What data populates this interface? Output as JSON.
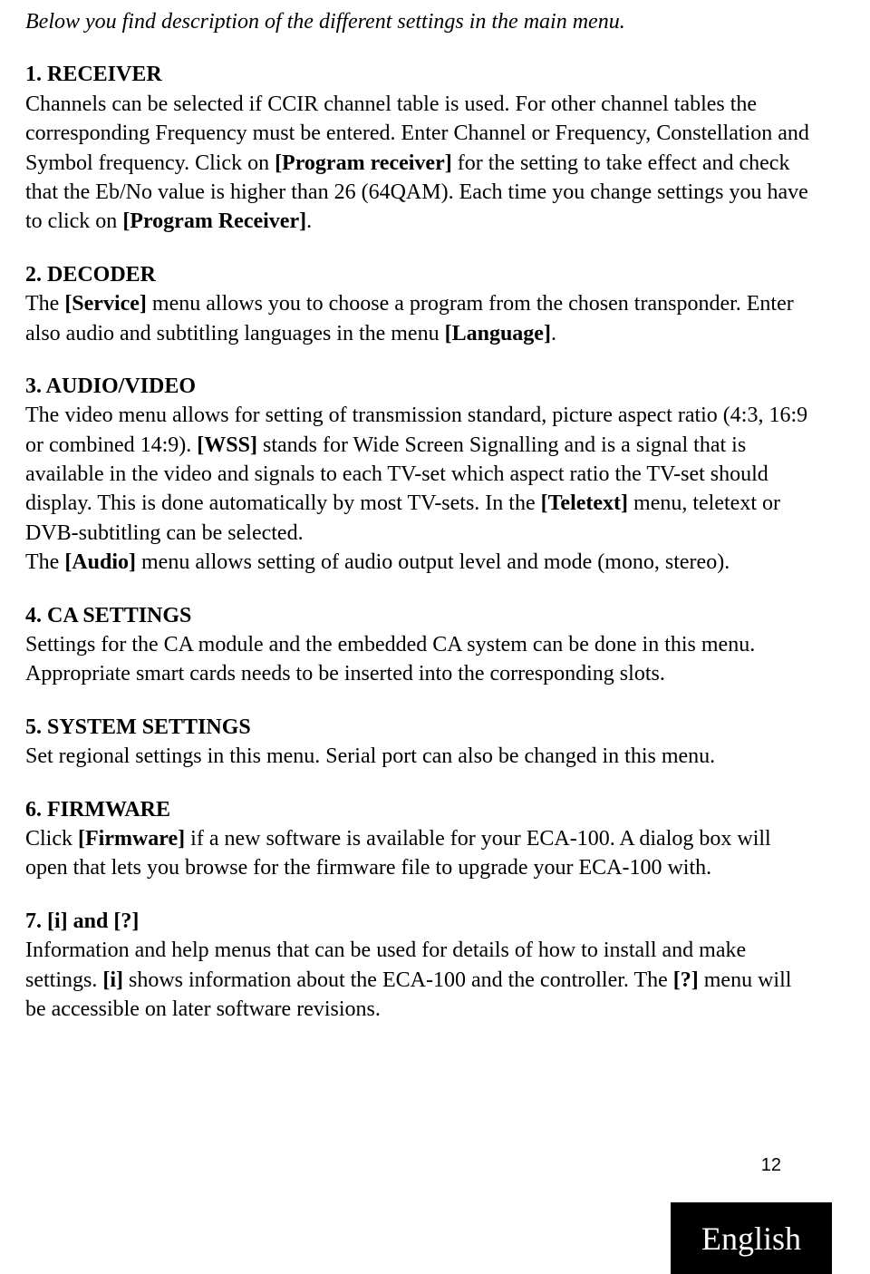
{
  "intro": "Below you find description of the different settings in the main menu.",
  "sections": {
    "s1": {
      "title": "1. RECEIVER",
      "p1a": "Channels can be selected if CCIR channel table is used. For other channel tables the corresponding Frequency must be entered. Enter Channel or Frequency, Constellation and Symbol frequency. Click on ",
      "p1b": "[Program receiver]",
      "p1c": " for the setting to take effect and check that the Eb/No value is higher than 26 (64QAM). Each time you change settings you have to click on ",
      "p1d": "[Program Receiver]",
      "p1e": "."
    },
    "s2": {
      "title": "2. DECODER",
      "p1a": "The ",
      "p1b": "[Service]",
      "p1c": " menu allows you to choose a program from the chosen transponder. Enter also audio and subtitling languages in the menu ",
      "p1d": "[Language]",
      "p1e": "."
    },
    "s3": {
      "title": "3. AUDIO/VIDEO",
      "p1a": "The video menu allows for setting of transmission standard, picture aspect ratio (4:3, 16:9 or combined 14:9). ",
      "p1b": "[WSS]",
      "p1c": " stands for Wide Screen Signalling and is a signal that is available in the video and signals to each TV-set which aspect ratio the TV-set should display. This is done automatically by most TV-sets. In the ",
      "p1d": "[Teletext]",
      "p1e": " menu, teletext or DVB-subtitling can be selected.",
      "p2a": "The ",
      "p2b": "[Audio]",
      "p2c": " menu allows setting of audio output level and mode (mono, stereo)."
    },
    "s4": {
      "title": "4. CA SETTINGS",
      "p1": "Settings for the CA module and the embedded CA system can be done in this menu. Appropriate smart cards needs to be inserted into the corresponding slots."
    },
    "s5": {
      "title": "5. SYSTEM SETTINGS",
      "p1": "Set regional settings in this menu. Serial port can also be changed in this menu."
    },
    "s6": {
      "title": "6. FIRMWARE",
      "p1a": "Click ",
      "p1b": "[Firmware]",
      "p1c": " if a new software is available for your ECA-100. A dialog box will open that lets you browse for the firmware file to upgrade your ECA-100 with."
    },
    "s7": {
      "title": "7. [i] and [?]",
      "p1a": "Information and help menus that can be used for details of how to install and make settings. ",
      "p1b": "[i]",
      "p1c": " shows information about the ECA-100 and the controller. The ",
      "p1d": "[?]",
      "p1e": " menu will be accessible on later software revisions."
    }
  },
  "page_number": "12",
  "language_tab": "English"
}
